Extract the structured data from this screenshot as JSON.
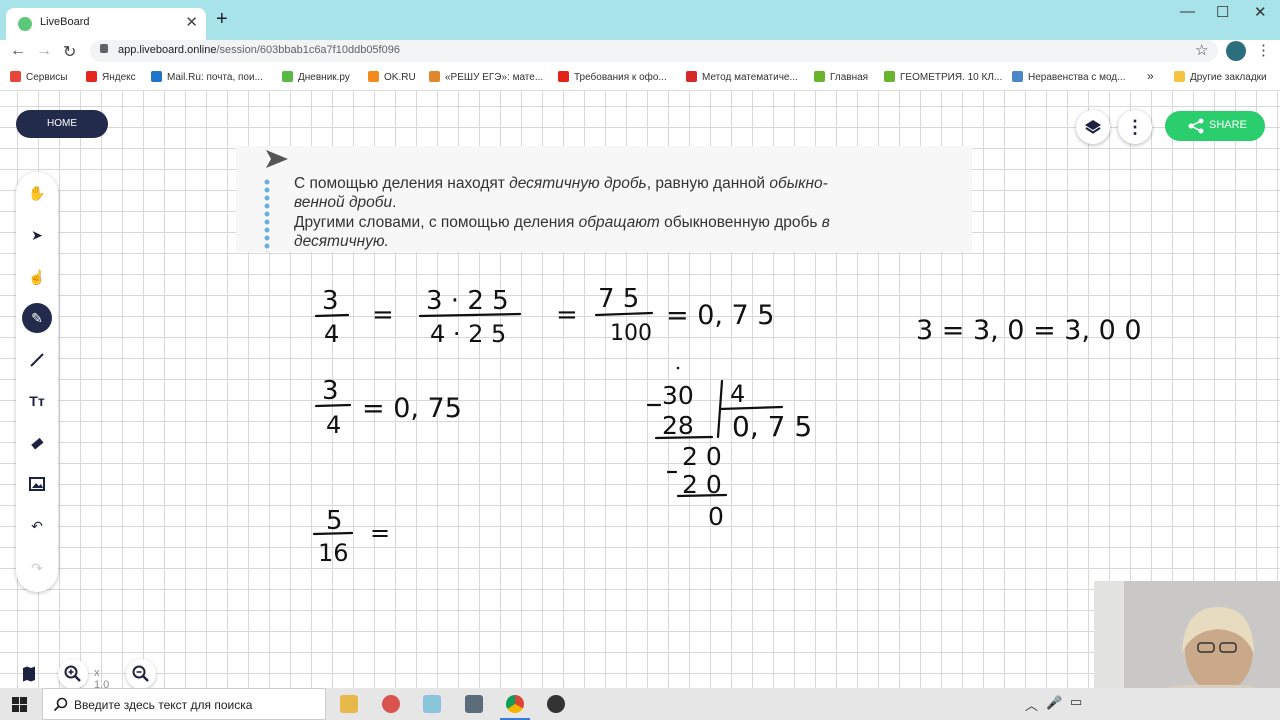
{
  "browser": {
    "tab_title": "LiveBoard",
    "url_domain": "app.liveboard.online",
    "url_path": "/session/603bbab1c6a7f10ddb05f096",
    "bookmarks": [
      {
        "label": "Сервисы",
        "color": "#e8453c"
      },
      {
        "label": "Яндекс",
        "color": "#e52620"
      },
      {
        "label": "Mail.Ru: почта, пои...",
        "color": "#1e74c8"
      },
      {
        "label": "Дневник.ру",
        "color": "#58b947"
      },
      {
        "label": "OK.RU",
        "color": "#f28b1b"
      },
      {
        "label": "«РЕШУ ЕГЭ»: мате...",
        "color": "#e0882d"
      },
      {
        "label": "Требования к офо...",
        "color": "#e62117"
      },
      {
        "label": "Метод математиче...",
        "color": "#d62828"
      },
      {
        "label": "Главная",
        "color": "#6ab42d"
      },
      {
        "label": "ГЕОМЕТРИЯ. 10 КЛ...",
        "color": "#6ab42d"
      },
      {
        "label": "Неравенства с мод...",
        "color": "#4a86c8"
      },
      {
        "label": "»",
        "color": ""
      },
      {
        "label": "Другие закладки",
        "color": "#f5c542"
      }
    ]
  },
  "app": {
    "home_label": "HOME",
    "share_label": "SHARE",
    "zoom_level": "x 1.0",
    "tools": [
      "hand-icon",
      "select-arrow-icon",
      "pointer-hand-icon",
      "pen-icon",
      "line-icon",
      "text-icon",
      "eraser-icon",
      "image-icon",
      "undo-icon",
      "redo-icon"
    ]
  },
  "textbook": {
    "line1_a": "С помощью деления находят ",
    "line1_b": "десятичную дробь",
    "line1_c": ", равную данной ",
    "line1_d": "обыкно-",
    "line2": "венной дроби",
    "line2_end": ".",
    "line3_a": "Другими словами, с помощью деления ",
    "line3_b": "обращают",
    "line3_c": " обыкновенную дробь ",
    "line3_d": "в",
    "line4": "десятичную."
  },
  "handwriting": {
    "eq1": {
      "num": "3",
      "den": "4",
      "num2": "3 · 2 5",
      "den2": "4 · 2 5",
      "num3": "7 5",
      "den3": "100",
      "result": "= 0, 7 5"
    },
    "eq2": {
      "num": "3",
      "den": "4",
      "result": "= 0, 75"
    },
    "eq3": {
      "num": "5",
      "den": "16",
      "result": "="
    },
    "eq4": "3 = 3, 0 = 3, 0 0",
    "division": {
      "dividend": "30",
      "divisor": "4",
      "sub1": "28",
      "quotient": "0, 7 5",
      "rem1": "2 0",
      "sub2": "2 0",
      "rem2": "0"
    }
  },
  "taskbar": {
    "search_placeholder": "Введите здесь текст для поиска"
  }
}
